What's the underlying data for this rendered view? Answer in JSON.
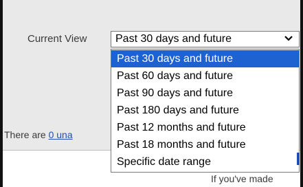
{
  "filter": {
    "label": "Current View",
    "selected": "Past 30 days and future",
    "options": [
      "Past 30 days and future",
      "Past 60 days and future",
      "Past 90 days and future",
      "Past 180 days and future",
      "Past 12 months and future",
      "Past 18 months and future",
      "Specific date range"
    ],
    "highlighted_index": 0
  },
  "status": {
    "prefix": "There are ",
    "link": "0 una"
  },
  "partial_text": {
    "bottom": "If you've made"
  },
  "colors": {
    "panel_bg": "#e9e9e9",
    "highlight": "#1e62d2",
    "link": "#1f4fb5"
  }
}
